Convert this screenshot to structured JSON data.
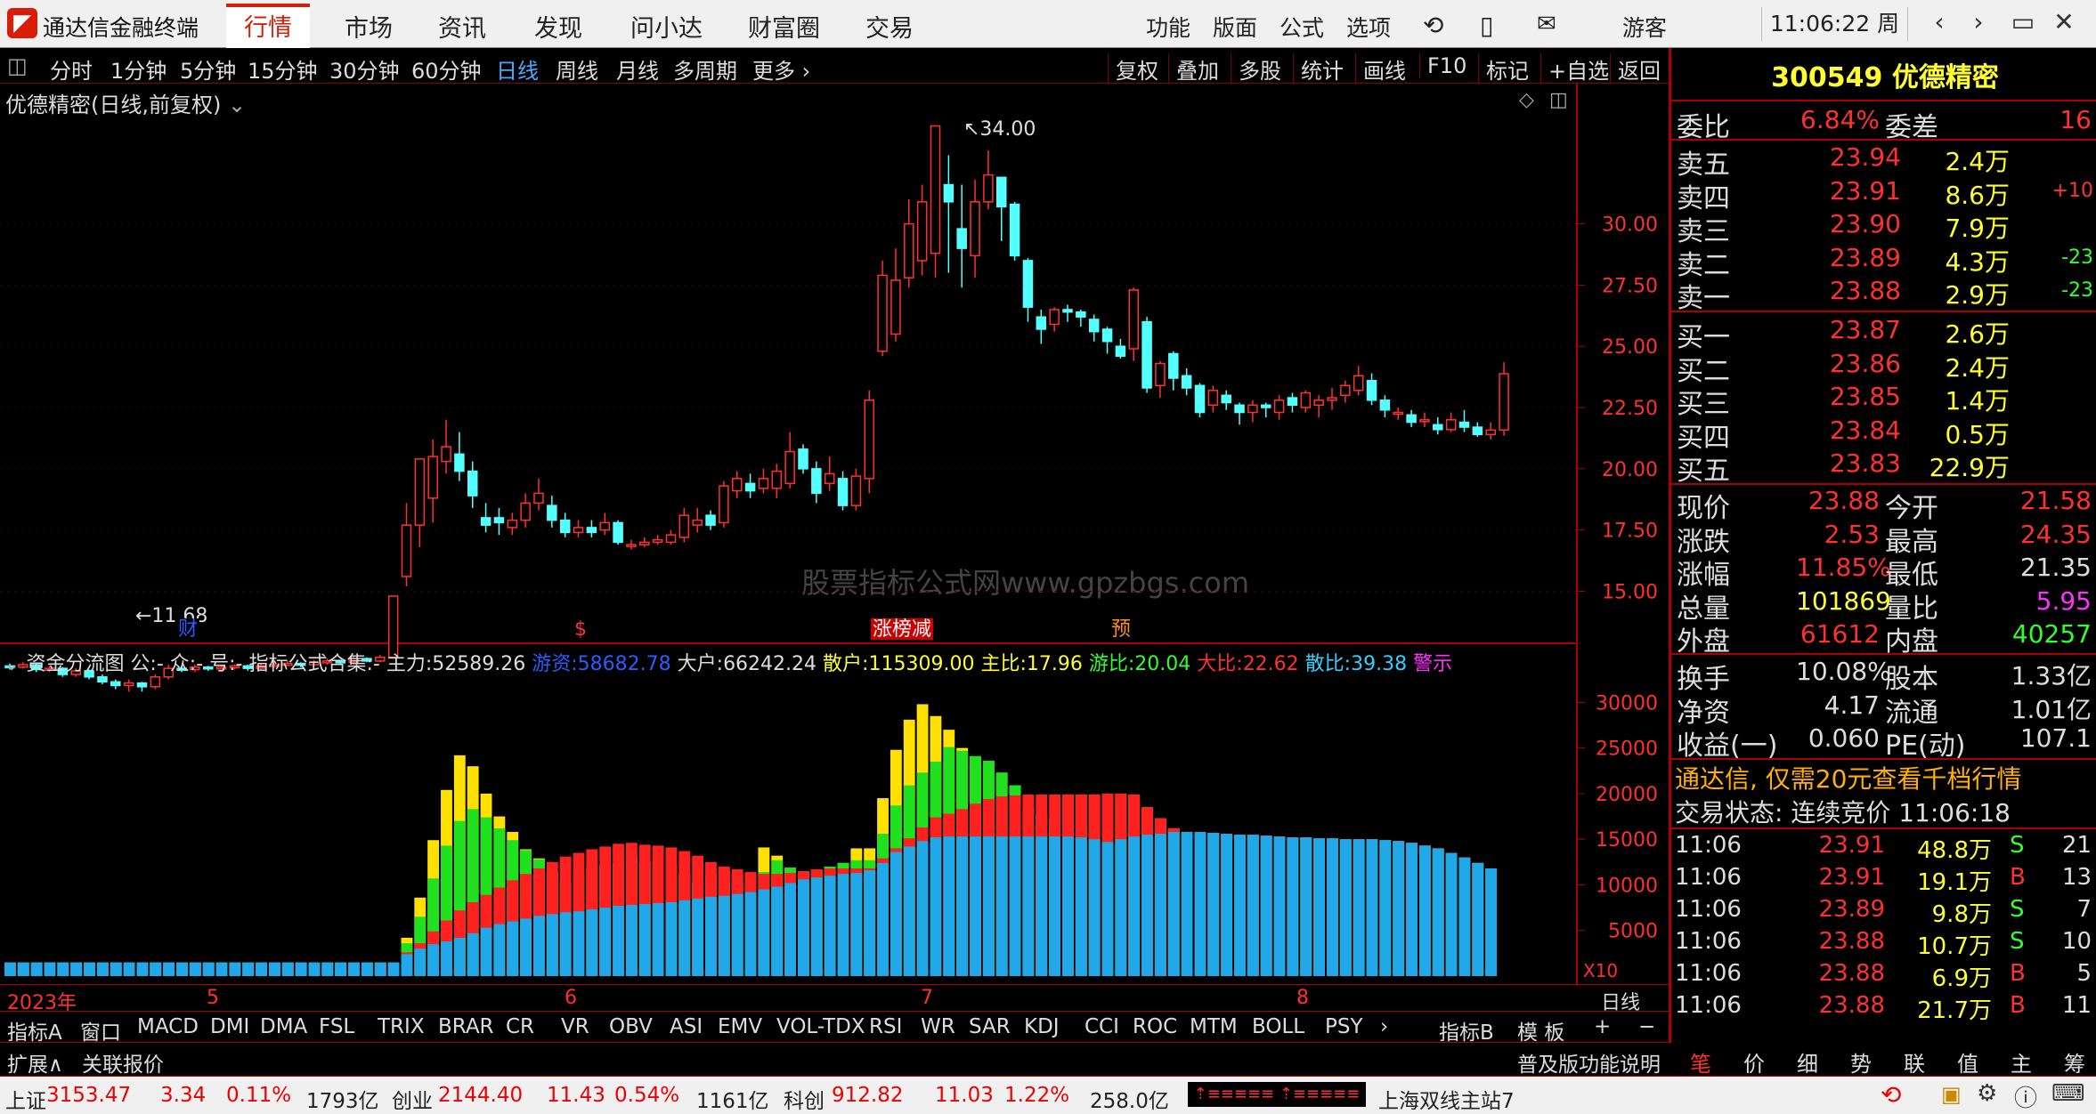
{
  "menu": {
    "logo_glyph": "◤",
    "app_title": "通达信金融终端",
    "tabs": [
      "行情",
      "市场",
      "资讯",
      "发现",
      "问小达",
      "财富圈",
      "交易"
    ],
    "right": [
      "功能",
      "版面",
      "公式",
      "选项"
    ],
    "user": "游客",
    "clock": "11:06:22 周四"
  },
  "periods": [
    "分时",
    "1分钟",
    "5分钟",
    "15分钟",
    "30分钟",
    "60分钟",
    "日线",
    "周线",
    "月线",
    "多周期",
    "更多 ›"
  ],
  "tools": [
    "复权",
    "叠加",
    "多股",
    "统计",
    "画线",
    "F10",
    "标记",
    "+自选",
    "返回"
  ],
  "chart_header": {
    "title": "优德精密(日线,前复权)",
    "watermark": "股票指标公式网www.gpzbgs.com"
  },
  "chart_data": {
    "type": "candlestick",
    "price_ticks": [
      "30.00",
      "27.50",
      "25.00",
      "22.50",
      "20.00",
      "17.50",
      "15.00"
    ],
    "price_range": [
      13.2,
      35.0
    ],
    "high_label": "34.00",
    "low_label": "11.68",
    "date_labels": [
      "2023年",
      "5",
      "6",
      "7",
      "8"
    ],
    "period_label": "日线",
    "candles": [
      [
        11.95,
        11.9,
        12.05,
        11.8
      ],
      [
        11.9,
        12.0,
        12.1,
        11.85
      ],
      [
        12.0,
        11.8,
        12.05,
        11.7
      ],
      [
        11.8,
        11.85,
        11.95,
        11.7
      ],
      [
        11.85,
        11.6,
        11.9,
        11.5
      ],
      [
        11.6,
        11.75,
        11.85,
        11.5
      ],
      [
        11.75,
        11.5,
        11.8,
        11.4
      ],
      [
        11.5,
        11.3,
        11.6,
        11.2
      ],
      [
        11.3,
        11.15,
        11.4,
        11.0
      ],
      [
        11.15,
        11.25,
        11.4,
        10.9
      ],
      [
        11.25,
        11.1,
        11.3,
        10.9
      ],
      [
        11.1,
        11.5,
        11.6,
        11.0
      ],
      [
        11.5,
        11.85,
        12.0,
        11.4
      ],
      [
        11.85,
        11.8,
        11.95,
        11.7
      ],
      [
        11.8,
        11.9,
        12.0,
        11.7
      ],
      [
        11.9,
        11.85,
        11.95,
        11.75
      ],
      [
        11.85,
        11.9,
        12.0,
        11.8
      ],
      [
        11.9,
        11.95,
        12.0,
        11.8
      ],
      [
        11.95,
        11.85,
        12.0,
        11.75
      ],
      [
        11.85,
        11.95,
        12.05,
        11.8
      ],
      [
        11.95,
        12.0,
        12.1,
        11.9
      ],
      [
        12.0,
        12.05,
        12.15,
        11.95
      ],
      [
        12.05,
        12.0,
        12.1,
        11.9
      ],
      [
        12.0,
        12.1,
        12.2,
        11.95
      ],
      [
        12.1,
        12.15,
        12.25,
        12.0
      ],
      [
        12.15,
        12.1,
        12.2,
        12.0
      ],
      [
        12.1,
        12.25,
        12.35,
        12.05
      ],
      [
        12.25,
        12.15,
        12.3,
        12.1
      ],
      [
        12.15,
        12.3,
        12.4,
        12.1
      ],
      [
        12.3,
        14.8,
        14.8,
        12.3
      ],
      [
        15.6,
        17.7,
        18.6,
        15.2
      ],
      [
        17.7,
        20.4,
        20.4,
        16.8
      ],
      [
        18.8,
        20.5,
        21.2,
        17.8
      ],
      [
        20.3,
        20.9,
        22.0,
        19.8
      ],
      [
        20.6,
        19.9,
        21.5,
        19.5
      ],
      [
        19.9,
        18.9,
        20.3,
        18.4
      ],
      [
        18.0,
        17.7,
        18.6,
        17.4
      ],
      [
        18.0,
        17.8,
        18.4,
        17.3
      ],
      [
        17.6,
        17.9,
        18.2,
        17.3
      ],
      [
        17.9,
        18.6,
        19.0,
        17.6
      ],
      [
        18.6,
        19.0,
        19.6,
        18.3
      ],
      [
        18.5,
        17.9,
        18.9,
        17.6
      ],
      [
        17.9,
        17.4,
        18.2,
        17.2
      ],
      [
        17.4,
        17.6,
        17.9,
        17.2
      ],
      [
        17.6,
        17.4,
        17.9,
        17.2
      ],
      [
        17.5,
        17.8,
        18.2,
        17.3
      ],
      [
        17.8,
        17.0,
        17.9,
        16.9
      ],
      [
        16.9,
        16.9,
        17.1,
        16.7
      ],
      [
        16.9,
        17.0,
        17.2,
        16.8
      ],
      [
        17.0,
        17.1,
        17.3,
        16.9
      ],
      [
        17.0,
        17.3,
        17.5,
        16.9
      ],
      [
        17.2,
        18.1,
        18.4,
        17.0
      ],
      [
        17.7,
        17.9,
        18.4,
        17.4
      ],
      [
        18.1,
        17.7,
        18.3,
        17.5
      ],
      [
        17.8,
        19.3,
        19.5,
        17.6
      ],
      [
        19.1,
        19.6,
        19.9,
        18.8
      ],
      [
        19.4,
        19.1,
        19.8,
        18.8
      ],
      [
        19.2,
        19.6,
        20.0,
        19.0
      ],
      [
        19.2,
        19.9,
        20.2,
        18.8
      ],
      [
        19.4,
        20.7,
        21.5,
        19.2
      ],
      [
        20.8,
        20.0,
        21.0,
        19.8
      ],
      [
        20.0,
        19.0,
        20.3,
        18.6
      ],
      [
        19.4,
        19.8,
        20.5,
        19.1
      ],
      [
        19.6,
        18.5,
        19.9,
        18.3
      ],
      [
        18.5,
        19.7,
        20.0,
        18.3
      ],
      [
        19.6,
        22.8,
        23.2,
        19.0
      ],
      [
        24.8,
        27.9,
        28.5,
        24.6
      ],
      [
        25.5,
        27.7,
        29.0,
        25.2
      ],
      [
        27.8,
        30.0,
        31.0,
        27.4
      ],
      [
        28.5,
        30.9,
        31.6,
        27.9
      ],
      [
        28.8,
        34.0,
        34.0,
        27.8
      ],
      [
        31.6,
        30.9,
        32.8,
        28.0
      ],
      [
        29.8,
        29.0,
        31.6,
        27.4
      ],
      [
        28.7,
        30.9,
        31.8,
        27.8
      ],
      [
        30.9,
        32.0,
        33.0,
        30.6
      ],
      [
        31.9,
        30.7,
        31.9,
        29.3
      ],
      [
        30.8,
        28.7,
        30.9,
        28.5
      ],
      [
        28.5,
        26.6,
        28.6,
        26.0
      ],
      [
        26.2,
        25.7,
        26.5,
        25.1
      ],
      [
        25.9,
        26.5,
        26.6,
        25.6
      ],
      [
        26.5,
        26.4,
        26.7,
        26.0
      ],
      [
        26.4,
        26.2,
        26.5,
        25.8
      ],
      [
        26.1,
        25.6,
        26.3,
        25.2
      ],
      [
        25.7,
        25.2,
        25.8,
        24.7
      ],
      [
        25.0,
        24.6,
        25.3,
        24.5
      ],
      [
        24.9,
        27.3,
        27.4,
        24.4
      ],
      [
        26.0,
        23.3,
        26.2,
        23.1
      ],
      [
        23.4,
        24.3,
        24.4,
        22.9
      ],
      [
        24.7,
        23.7,
        24.8,
        23.2
      ],
      [
        23.8,
        23.3,
        24.1,
        23.0
      ],
      [
        23.4,
        22.3,
        23.5,
        22.1
      ],
      [
        22.6,
        23.2,
        23.4,
        22.3
      ],
      [
        23.0,
        22.7,
        23.2,
        22.4
      ],
      [
        22.6,
        22.3,
        22.7,
        21.8
      ],
      [
        22.3,
        22.6,
        22.8,
        21.9
      ],
      [
        22.6,
        22.5,
        22.7,
        22.1
      ],
      [
        22.3,
        22.8,
        23.0,
        22.0
      ],
      [
        22.9,
        22.6,
        23.1,
        22.3
      ],
      [
        22.5,
        23.1,
        23.2,
        22.3
      ],
      [
        22.6,
        22.8,
        23.0,
        22.1
      ],
      [
        22.8,
        22.9,
        23.3,
        22.4
      ],
      [
        23.0,
        23.4,
        23.6,
        22.7
      ],
      [
        23.2,
        23.8,
        24.2,
        23.0
      ],
      [
        23.6,
        22.8,
        23.9,
        22.6
      ],
      [
        22.8,
        22.4,
        23.0,
        22.1
      ],
      [
        22.3,
        22.3,
        22.5,
        22.0
      ],
      [
        22.2,
        21.9,
        22.4,
        21.7
      ],
      [
        22.0,
        22.0,
        22.3,
        21.7
      ],
      [
        21.8,
        21.6,
        22.1,
        21.4
      ],
      [
        21.6,
        22.0,
        22.3,
        21.5
      ],
      [
        21.9,
        21.7,
        22.4,
        21.5
      ],
      [
        21.7,
        21.4,
        21.9,
        21.3
      ],
      [
        21.4,
        21.58,
        21.9,
        21.2
      ],
      [
        21.58,
        23.88,
        24.35,
        21.35
      ]
    ],
    "flow_ticks": [
      "30000",
      "25000",
      "20000",
      "15000",
      "10000",
      "5000"
    ],
    "flow_range": [
      0,
      31500
    ],
    "flow_unit": "X10",
    "flow_series": [
      "资金分流",
      "主力",
      "游资",
      "大户"
    ],
    "flow_retail": [
      1500,
      1500,
      1500,
      1500,
      1500,
      1500,
      1500,
      1500,
      1500,
      1500,
      1500,
      1500,
      1500,
      1500,
      1500,
      1500,
      1500,
      1500,
      1500,
      1500,
      1500,
      1500,
      1500,
      1500,
      1500,
      1500,
      1500,
      1500,
      1500,
      1500,
      2400,
      3000,
      3500,
      3800,
      4200,
      4700,
      5300,
      5700,
      6000,
      6300,
      6600,
      6800,
      7000,
      7100,
      7300,
      7500,
      7700,
      7800,
      7900,
      8000,
      8100,
      8300,
      8500,
      8700,
      8800,
      9000,
      9200,
      9500,
      9800,
      10200,
      10600,
      10800,
      11000,
      11200,
      11300,
      11600,
      12400,
      13600,
      14200,
      14800,
      15200,
      15300,
      15300,
      15300,
      15300,
      15300,
      15300,
      15300,
      15300,
      15300,
      15300,
      15200,
      15000,
      14700,
      15000,
      15300,
      15500,
      15600,
      15800,
      15800,
      15800,
      15700,
      15600,
      15500,
      15500,
      15400,
      15300,
      15200,
      15200,
      15100,
      15100,
      15000,
      15000,
      15000,
      14900,
      14800,
      14600,
      14300,
      14000,
      13500,
      13000,
      12400,
      11800
    ],
    "flow_big": [
      1500,
      1500,
      1500,
      1500,
      1500,
      1500,
      1500,
      1500,
      1500,
      1500,
      1500,
      1500,
      1500,
      1500,
      1500,
      1500,
      1500,
      1500,
      1500,
      1500,
      1500,
      1500,
      1500,
      1500,
      1500,
      1500,
      1500,
      1500,
      1500,
      1500,
      2600,
      3600,
      4900,
      6100,
      7200,
      8100,
      8900,
      9700,
      10500,
      11200,
      11800,
      12500,
      13100,
      13500,
      13900,
      14200,
      14500,
      14600,
      14400,
      14300,
      14100,
      13700,
      13200,
      12500,
      12000,
      11700,
      11400,
      11200,
      11200,
      11300,
      11500,
      11700,
      11800,
      11800,
      11800,
      11800,
      12900,
      14000,
      15100,
      16300,
      17400,
      17800,
      18300,
      18900,
      19400,
      19700,
      19800,
      19900,
      19900,
      19900,
      19900,
      19900,
      19900,
      20000,
      20000,
      19900,
      18500,
      17300,
      16200,
      15800,
      15800,
      15700,
      15600,
      15500,
      15500,
      15400,
      15300,
      15200,
      15200,
      15100,
      15100,
      15000,
      15000,
      15000,
      14900,
      14800,
      14600,
      14300,
      14000,
      13500,
      13000,
      12400,
      11800
    ],
    "flow_hot": [
      1500,
      1500,
      1500,
      1500,
      1500,
      1500,
      1500,
      1500,
      1500,
      1500,
      1500,
      1500,
      1500,
      1500,
      1500,
      1500,
      1500,
      1500,
      1500,
      1500,
      1500,
      1500,
      1500,
      1500,
      1500,
      1500,
      1500,
      1500,
      1500,
      1500,
      3600,
      6500,
      10700,
      14300,
      17000,
      18300,
      17400,
      16200,
      14900,
      13800,
      12800,
      11400,
      10400,
      11200,
      11900,
      12100,
      12400,
      13100,
      12500,
      12700,
      12100,
      11300,
      10300,
      10300,
      10500,
      10300,
      10500,
      11400,
      12700,
      11900,
      11500,
      11600,
      12000,
      12400,
      12700,
      12700,
      15600,
      18700,
      20900,
      22300,
      23500,
      25100,
      24700,
      24100,
      23600,
      22300,
      20900,
      18600,
      17800,
      17200,
      19900,
      19900,
      19900,
      20000,
      20000,
      19900,
      18500,
      17300,
      16200,
      15800,
      15800,
      15700,
      15600,
      15500,
      15500,
      15400,
      15300,
      15200,
      15200,
      15100,
      15100,
      15000,
      15000,
      15000,
      14900,
      14800,
      14600,
      14300,
      14000,
      13500,
      13000,
      12400,
      11800
    ],
    "flow_total": [
      1500,
      1500,
      1500,
      1500,
      1500,
      1500,
      1500,
      1500,
      1500,
      1500,
      1500,
      1500,
      1500,
      1500,
      1500,
      1500,
      1500,
      1500,
      1500,
      1500,
      1500,
      1500,
      1500,
      1500,
      1500,
      1500,
      1500,
      1500,
      1500,
      1500,
      4200,
      8600,
      14900,
      20400,
      24200,
      23000,
      20000,
      17500,
      15800,
      13900,
      12900,
      11400,
      10400,
      11200,
      11900,
      12100,
      12400,
      13100,
      12500,
      12700,
      12100,
      11300,
      10300,
      11100,
      11500,
      11200,
      11300,
      14100,
      13200,
      11900,
      11500,
      11600,
      12000,
      12400,
      14000,
      14000,
      19500,
      24800,
      28100,
      29800,
      28500,
      27000,
      25000,
      24100,
      23600,
      22300,
      20900,
      18600,
      17800,
      17200,
      19900,
      19900,
      19900,
      20000,
      20000,
      19900,
      18500,
      17300,
      16200,
      15800,
      15800,
      15700,
      15600,
      15500,
      15500,
      15400,
      15300,
      15200,
      15200,
      15100,
      15100,
      15000,
      15000,
      15000,
      14900,
      14800,
      14600,
      14300,
      14000,
      13500,
      13000,
      12400,
      11800
    ],
    "events": [
      "财",
      "$",
      "涨榜减",
      "预"
    ]
  },
  "indicator": {
    "title": "资金分流图 公:- 众:- 号:- 指标公式合集:-",
    "main": {
      "label": "主力:",
      "value": "52589.26"
    },
    "hot": {
      "label": "游资:",
      "value": "58682.78"
    },
    "big": {
      "label": "大户:",
      "value": "66242.24"
    },
    "retail": {
      "label": "散户:",
      "value": "115309.00"
    },
    "mainratio": {
      "label": "主比:",
      "value": "17.96"
    },
    "hotratio": {
      "label": "游比:",
      "value": "20.04"
    },
    "bigratio": {
      "label": "大比:",
      "value": "22.62"
    },
    "retailratio": {
      "label": "散比:",
      "value": "39.38"
    },
    "warn": "警示"
  },
  "indicator_tabs": [
    "指标A",
    "窗口",
    "MACD",
    "DMI",
    "DMA",
    "FSL",
    "TRIX",
    "BRAR",
    "CR",
    "VR",
    "OBV",
    "ASI",
    "EMV",
    "VOL-TDX",
    "RSI",
    "WR",
    "SAR",
    "KDJ",
    "CCI",
    "ROC",
    "MTM",
    "BOLL",
    "PSY",
    "›",
    "指标B",
    "模 板",
    "+",
    "−"
  ],
  "ext": {
    "expand": "扩展∧",
    "related": "关联报价",
    "popular": "普及版功能说明"
  },
  "bottom_tabs": [
    "笔",
    "价",
    "细",
    "势",
    "联",
    "值",
    "主",
    "筹"
  ],
  "quote": {
    "code_name": "300549 优德精密",
    "wb_label": "委比",
    "wb_value": "6.84%",
    "wc_label": "委差",
    "wc_value": "16",
    "asks": [
      {
        "label": "卖五",
        "price": "23.94",
        "vol": "2.4万",
        "diff": ""
      },
      {
        "label": "卖四",
        "price": "23.91",
        "vol": "8.6万",
        "diff": "+10"
      },
      {
        "label": "卖三",
        "price": "23.90",
        "vol": "7.9万",
        "diff": ""
      },
      {
        "label": "卖二",
        "price": "23.89",
        "vol": "4.3万",
        "diff": "-23"
      },
      {
        "label": "卖一",
        "price": "23.88",
        "vol": "2.9万",
        "diff": "-23"
      }
    ],
    "bids": [
      {
        "label": "买一",
        "price": "23.87",
        "vol": "2.6万",
        "diff": ""
      },
      {
        "label": "买二",
        "price": "23.86",
        "vol": "2.4万",
        "diff": ""
      },
      {
        "label": "买三",
        "price": "23.85",
        "vol": "1.4万",
        "diff": ""
      },
      {
        "label": "买四",
        "price": "23.84",
        "vol": "0.5万",
        "diff": ""
      },
      {
        "label": "买五",
        "price": "23.83",
        "vol": "22.9万",
        "diff": ""
      }
    ],
    "stats1": [
      [
        "现价",
        "23.88",
        "今开",
        "21.58"
      ],
      [
        "涨跌",
        "2.53",
        "最高",
        "24.35"
      ],
      [
        "涨幅",
        "11.85%",
        "最低",
        "21.35"
      ],
      [
        "总量",
        "101869",
        "量比",
        "5.95"
      ],
      [
        "外盘",
        "61612",
        "内盘",
        "40257"
      ]
    ],
    "stats2": [
      [
        "换手",
        "10.08%",
        "股本",
        "1.33亿"
      ],
      [
        "净资",
        "4.17",
        "流通",
        "1.01亿"
      ],
      [
        "收益(一)",
        "0.060",
        "PE(动)",
        "107.1"
      ]
    ],
    "promo": "通达信, 仅需20元查看千档行情",
    "trade_status": "交易状态: 连续竞价 11:06:18",
    "ticks": [
      [
        "11:06",
        "23.91",
        "48.8万",
        "S",
        "21"
      ],
      [
        "11:06",
        "23.91",
        "19.1万",
        "B",
        "13"
      ],
      [
        "11:06",
        "23.89",
        "9.8万",
        "S",
        "7"
      ],
      [
        "11:06",
        "23.88",
        "10.7万",
        "S",
        "10"
      ],
      [
        "11:06",
        "23.88",
        "6.9万",
        "B",
        "5"
      ],
      [
        "11:06",
        "23.88",
        "21.7万",
        "B",
        "11"
      ]
    ]
  },
  "status": {
    "sh_label": "上证",
    "sh_value": "3153.47",
    "sh_change": "3.34",
    "sh_pct": "0.11%",
    "sh_amount": "1793亿",
    "cy_label": "创业",
    "cy_value": "2144.40",
    "cy_change": "11.43",
    "cy_pct": "0.54%",
    "cy_amount": "1161亿",
    "kc_label": "科创",
    "kc_value": "912.82",
    "kc_change": "11.03",
    "kc_pct": "1.22%",
    "kc_amount": "258.0亿",
    "breadth": "⇡≡≡≡≡≡ ⇡≡≡≡≡≡",
    "server": "上海双线主站7"
  }
}
